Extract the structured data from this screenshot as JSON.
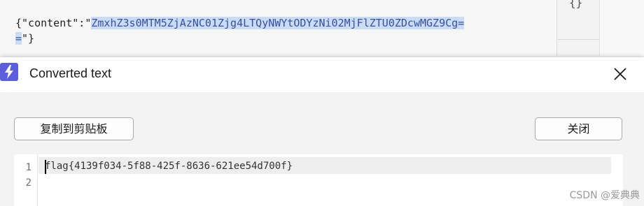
{
  "background_editor": {
    "line1_prefix": "{\"content\":\"",
    "line1_selected": "ZmxhZ3s0MTM5ZjAzNC01Zjg4LTQyNWYtODYzNi02MjFlZTU0ZDcwMGZ9Cg=",
    "line2_selected": "=",
    "line2_suffix": "\"}",
    "side_icon": "{}",
    "selection_color": "#c9dcf4"
  },
  "dialog": {
    "app_icon": "lightning-icon",
    "title": "Converted text",
    "close_icon": "close-icon",
    "copy_button_label": "复制到剪贴板",
    "close_button_label": "关闭",
    "accent_color": "#5b5fdc"
  },
  "result_editor": {
    "line_numbers": [
      "1",
      "2"
    ],
    "lines": [
      "flag{4139f034-5f88-425f-8636-621ee54d700f}",
      ""
    ]
  },
  "watermark": "CSDN @爱典典"
}
